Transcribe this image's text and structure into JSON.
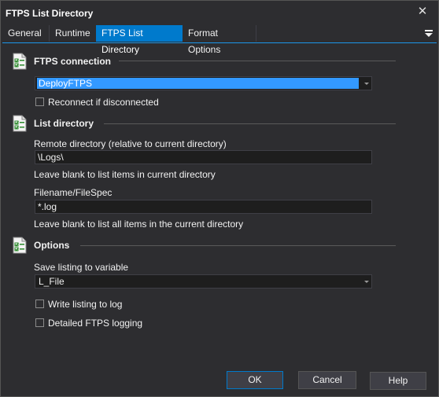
{
  "window": {
    "title": "FTPS List Directory",
    "close_glyph": "✕"
  },
  "tabs": [
    {
      "label": "General",
      "active": false
    },
    {
      "label": "Runtime",
      "active": false
    },
    {
      "label": "FTPS List Directory",
      "active": true
    },
    {
      "label": "Format Options",
      "active": false
    }
  ],
  "sections": {
    "connection": {
      "title": "FTPS connection",
      "combo_value": "DeployFTPS",
      "reconnect_label": "Reconnect if disconnected",
      "reconnect_checked": false
    },
    "list_directory": {
      "title": "List directory",
      "remote_dir_label": "Remote directory (relative to current directory)",
      "remote_dir_value": "\\Logs\\",
      "remote_dir_hint": "Leave blank to list items in current directory",
      "filespec_label": "Filename/FileSpec",
      "filespec_value": "*.log",
      "filespec_hint": "Leave blank to list all items in the current directory"
    },
    "options": {
      "title": "Options",
      "save_var_label": "Save listing to variable",
      "save_var_value": "L_File",
      "write_log_label": "Write listing to log",
      "write_log_checked": false,
      "detailed_label": "Detailed FTPS logging",
      "detailed_checked": false
    }
  },
  "buttons": {
    "ok": "OK",
    "cancel": "Cancel",
    "help": "Help"
  },
  "colors": {
    "background": "#2d2d30",
    "accent": "#007acc",
    "selection": "#3399ff"
  }
}
